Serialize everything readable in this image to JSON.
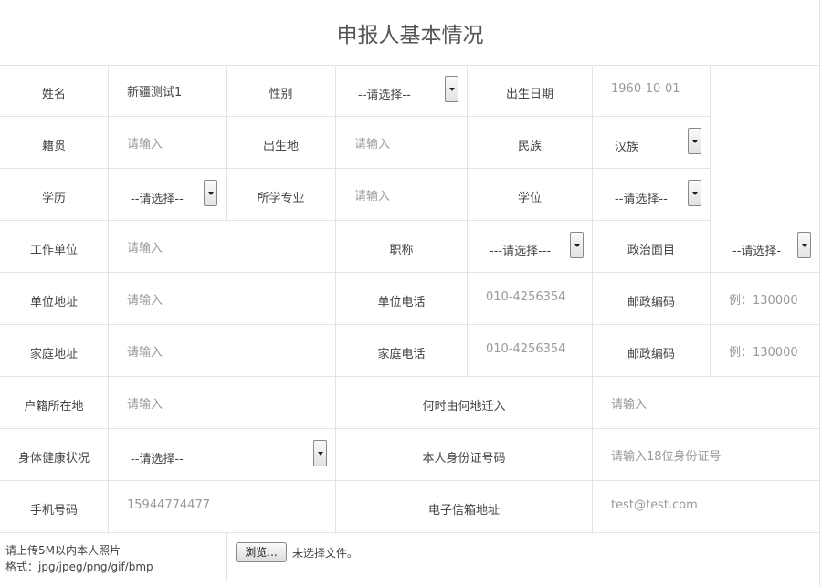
{
  "title": "申报人基本情况",
  "fields": {
    "name": {
      "label": "姓名",
      "value": "新疆测试1"
    },
    "gender": {
      "label": "性别",
      "select": "--请选择--"
    },
    "birth": {
      "label": "出生日期",
      "value": "1960-10-01"
    },
    "native": {
      "label": "籍贯",
      "placeholder": "请输入"
    },
    "birthplace": {
      "label": "出生地",
      "placeholder": "请输入"
    },
    "ethnic": {
      "label": "民族",
      "select": "汉族"
    },
    "education": {
      "label": "学历",
      "select": "--请选择--"
    },
    "major": {
      "label": "所学专业",
      "placeholder": "请输入"
    },
    "degree": {
      "label": "学位",
      "select": "--请选择--"
    },
    "employer": {
      "label": "工作单位",
      "placeholder": "请输入"
    },
    "title_rank": {
      "label": "职称",
      "select": "---请选择---"
    },
    "political": {
      "label": "政治面目",
      "select": "--请选择-"
    },
    "work_address": {
      "label": "单位地址",
      "placeholder": "请输入"
    },
    "work_phone": {
      "label": "单位电话",
      "placeholder": "010-4256354"
    },
    "work_zip": {
      "label": "邮政编码",
      "placeholder": "例：130000"
    },
    "home_address": {
      "label": "家庭地址",
      "placeholder": "请输入"
    },
    "home_phone": {
      "label": "家庭电话",
      "placeholder": "010-4256354"
    },
    "home_zip": {
      "label": "邮政编码",
      "placeholder": "例：130000"
    },
    "household": {
      "label": "户籍所在地",
      "placeholder": "请输入"
    },
    "moved_from": {
      "label": "何时由何地迁入",
      "placeholder": "请输入"
    },
    "health": {
      "label": "身体健康状况",
      "select": "--请选择--"
    },
    "id_number": {
      "label": "本人身份证号码",
      "placeholder": "请输入18位身份证号"
    },
    "mobile": {
      "label": "手机号码",
      "placeholder": "15944774477"
    },
    "email": {
      "label": "电子信箱地址",
      "placeholder": "test@test.com"
    }
  },
  "upload": {
    "hint_line1": "请上传5M以内本人照片",
    "hint_line2": "格式：jpg/jpeg/png/gif/bmp",
    "browse_label": "浏览...",
    "no_file": "未选择文件。"
  }
}
